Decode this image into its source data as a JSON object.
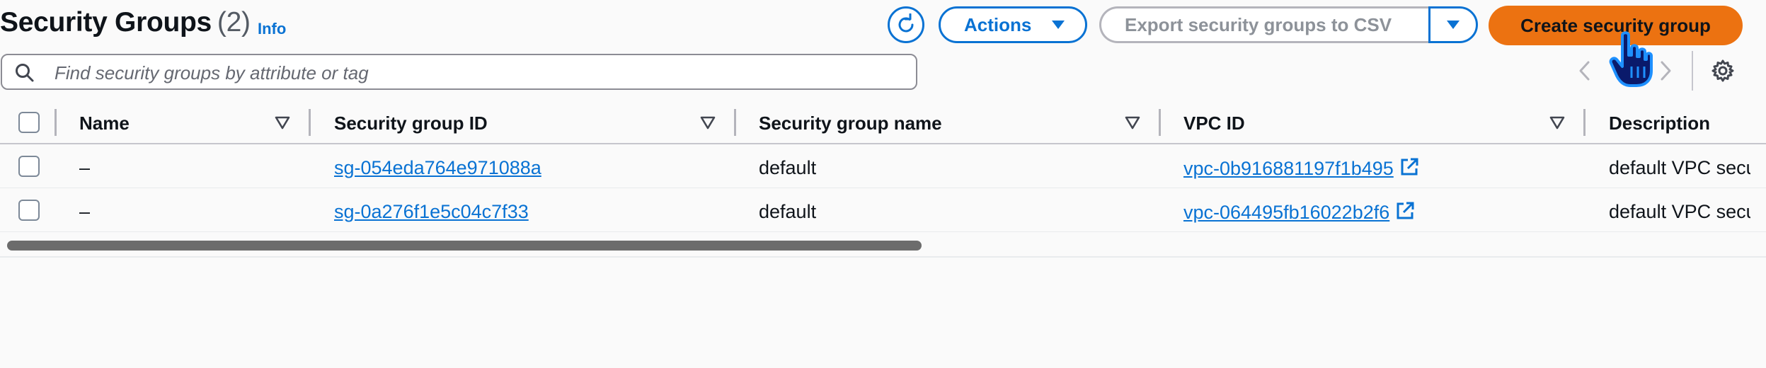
{
  "header": {
    "title": "Security Groups",
    "count": "(2)",
    "info_label": "Info",
    "actions_label": "Actions",
    "export_label": "Export security groups to CSV",
    "create_label": "Create security group"
  },
  "search": {
    "placeholder": "Find security groups by attribute or tag",
    "value": ""
  },
  "table": {
    "columns": [
      "Name",
      "Security group ID",
      "Security group name",
      "VPC ID",
      "Description"
    ],
    "rows": [
      {
        "name": "–",
        "group_id": "sg-054eda764e971088a",
        "group_name": "default",
        "vpc_id": "vpc-0b916881197f1b495",
        "description": "default VPC security group"
      },
      {
        "name": "–",
        "group_id": "sg-0a276f1e5c04c7f33",
        "group_name": "default",
        "vpc_id": "vpc-064495fb16022b2f6",
        "description": "default VPC security group"
      }
    ]
  },
  "colors": {
    "link": "#0972d3",
    "primary_button": "#ec7211",
    "border": "#c6c6cd"
  },
  "icons": [
    "refresh-icon",
    "caret-down-icon",
    "search-icon",
    "chevron-left-icon",
    "chevron-right-icon",
    "settings-gear-icon",
    "sort-icon",
    "external-link-icon",
    "hand-pointer-cursor"
  ]
}
